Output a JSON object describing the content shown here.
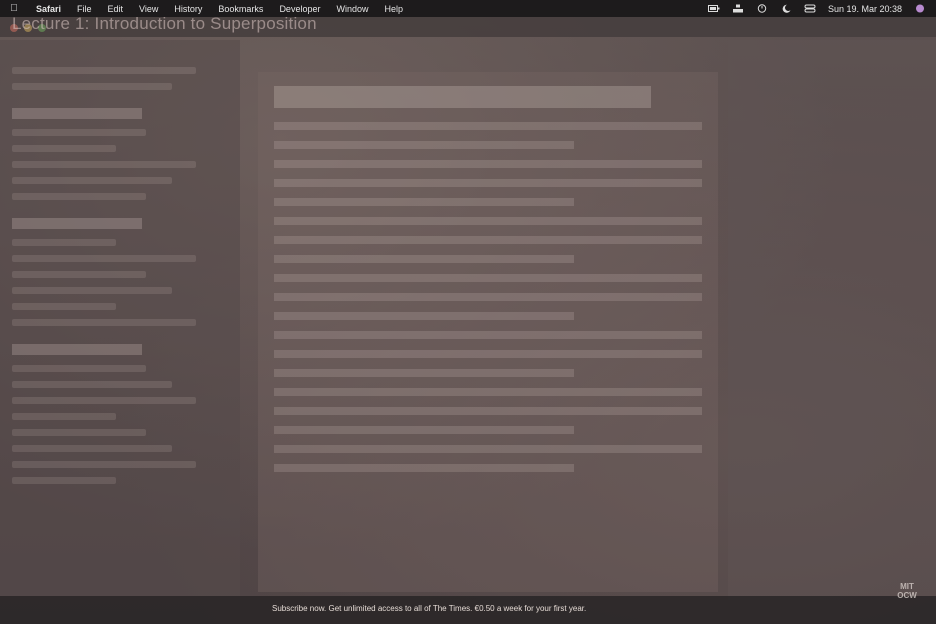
{
  "menubar": {
    "apple_icon": "apple-logo-icon",
    "items": [
      "Safari",
      "File",
      "Edit",
      "View",
      "History",
      "Bookmarks",
      "Developer",
      "Window",
      "Help"
    ],
    "clock": "Sun 19. Mar 20:38",
    "status_icons": [
      "battery-icon",
      "vpn-icon",
      "timer-icon",
      "moon-icon",
      "control-center-icon",
      "siri-icon"
    ]
  },
  "window": {
    "lecture_title": "Lecture 1: Introduction to Superposition"
  },
  "footer": {
    "subscribe_text": "Subscribe now. Get unlimited access to all of The Times. €0.50 a week for your first year.",
    "logo_text": "MIT OCW"
  }
}
